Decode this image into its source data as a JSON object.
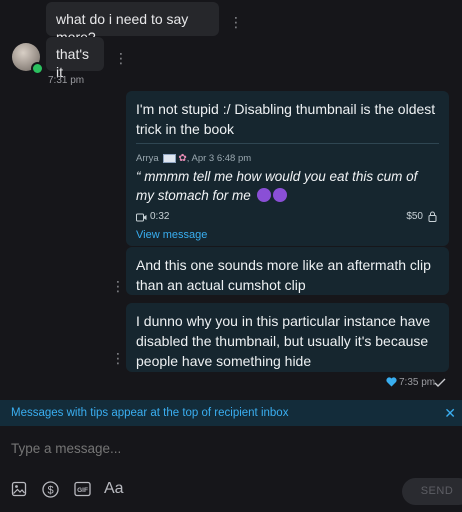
{
  "thread": {
    "incoming": [
      {
        "text": "what do i need to say more?"
      },
      {
        "text": "that's it"
      }
    ],
    "incoming_time": "7:31 pm",
    "outgoing": {
      "message_1": "I'm not stupid :/ Disabling thumbnail is the oldest trick in the book",
      "quoted": {
        "author": "Arrya",
        "date": "Apr 3 6:48 pm",
        "text": "“ mmmm tell me how would you eat this cum of my stomach for me",
        "duration": "0:32",
        "price": "$50",
        "link": "View message"
      },
      "message_2": "And this one sounds more like an aftermath clip than an actual cumshot clip",
      "message_3": "I dunno why you in this particular instance have disabled the thumbnail, but usually it's because people have something hide",
      "time": "7:35 pm"
    }
  },
  "tip_notice": "Messages with tips appear at the top of recipient inbox",
  "composer": {
    "placeholder": "Type a message...",
    "format_label": "Aa",
    "send_label": "SEND"
  },
  "colors": {
    "accent": "#39aef0",
    "outgoing_bg": "#16262f",
    "incoming_bg": "#26272b",
    "online": "#2bc15f"
  }
}
